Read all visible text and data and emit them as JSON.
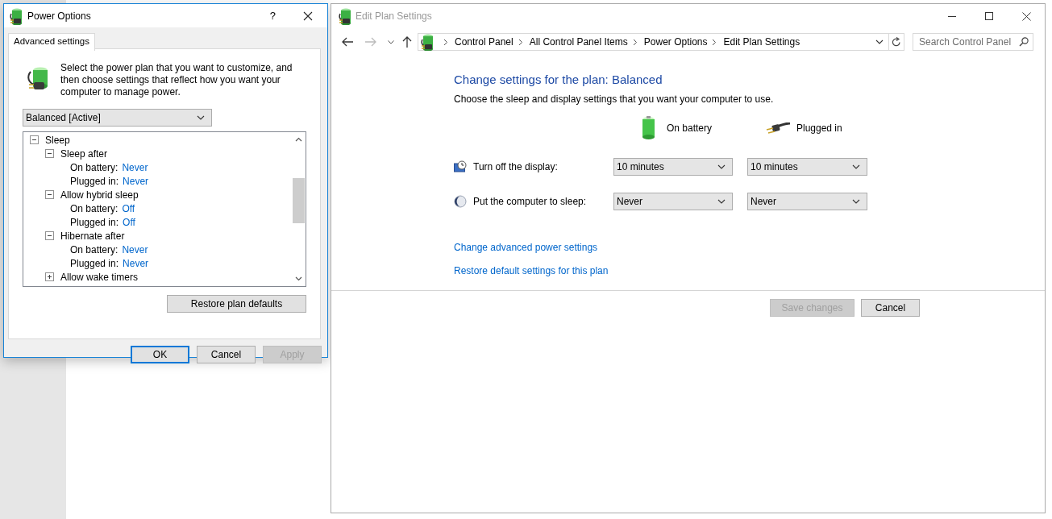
{
  "dialog": {
    "title": "Power Options",
    "help_button": "?",
    "tabs": [
      {
        "label": "Advanced settings",
        "selected": true
      }
    ],
    "description": "Select the power plan that you want to customize, and then choose settings that reflect how you want your computer to manage power.",
    "plan": "Balanced [Active]",
    "tree": [
      {
        "label": "Sleep",
        "expanded": true,
        "children": [
          {
            "label": "Sleep after",
            "expanded": true,
            "settings": [
              {
                "label": "On battery:",
                "value": "Never"
              },
              {
                "label": "Plugged in:",
                "value": "Never"
              }
            ]
          },
          {
            "label": "Allow hybrid sleep",
            "expanded": true,
            "settings": [
              {
                "label": "On battery:",
                "value": "Off"
              },
              {
                "label": "Plugged in:",
                "value": "Off"
              }
            ]
          },
          {
            "label": "Hibernate after",
            "expanded": true,
            "settings": [
              {
                "label": "On battery:",
                "value": "Never"
              },
              {
                "label": "Plugged in:",
                "value": "Never"
              }
            ]
          },
          {
            "label": "Allow wake timers",
            "expanded": false
          }
        ]
      }
    ],
    "restore_button": "Restore plan defaults",
    "buttons": [
      {
        "label": "OK",
        "default": true,
        "disabled": false
      },
      {
        "label": "Cancel",
        "default": false,
        "disabled": false
      },
      {
        "label": "Apply",
        "default": false,
        "disabled": true
      }
    ]
  },
  "window": {
    "title": "Edit Plan Settings",
    "nav": {
      "back_enabled": true,
      "forward_enabled": false
    },
    "breadcrumb": [
      "Control Panel",
      "All Control Panel Items",
      "Power Options",
      "Edit Plan Settings"
    ],
    "search": {
      "placeholder": "Search Control Panel"
    },
    "heading": "Change settings for the plan: Balanced",
    "subtitle": "Choose the sleep and display settings that you want your computer to use.",
    "columns": [
      {
        "label": "On battery",
        "kind": "battery"
      },
      {
        "label": "Plugged in",
        "kind": "plug"
      }
    ],
    "settings": [
      {
        "label": "Turn off the display:",
        "kind": "display",
        "values": [
          "10 minutes",
          "10 minutes"
        ]
      },
      {
        "label": "Put the computer to sleep:",
        "kind": "sleep",
        "values": [
          "Never",
          "Never"
        ]
      }
    ],
    "links": [
      "Change advanced power settings",
      "Restore default settings for this plan"
    ],
    "buttons": [
      {
        "label": "Save changes",
        "disabled": true
      },
      {
        "label": "Cancel",
        "disabled": false
      }
    ]
  }
}
